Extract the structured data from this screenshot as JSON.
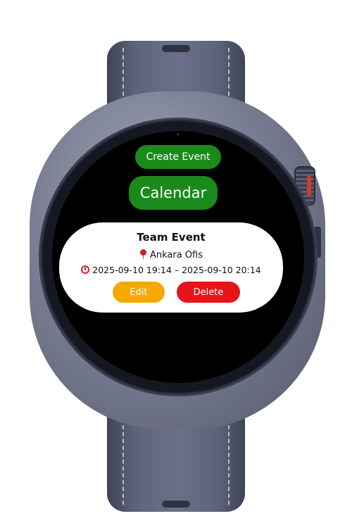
{
  "app": {
    "create_event_label": "Create Event",
    "title_button_label": "Calendar"
  },
  "event": {
    "title": "Team Event",
    "location": "Ankara Ofis",
    "time_range": "2025-09-10 19:14 – 2025-09-10 20:14",
    "edit_label": "Edit",
    "delete_label": "Delete"
  },
  "icons": {
    "location": "pin-icon",
    "time": "alarm-clock-icon"
  },
  "colors": {
    "primary_green": "#1a8a1a",
    "edit_orange": "#f5a800",
    "delete_red": "#e8141a",
    "card_background": "#ffffff",
    "screen_background": "#000000"
  }
}
